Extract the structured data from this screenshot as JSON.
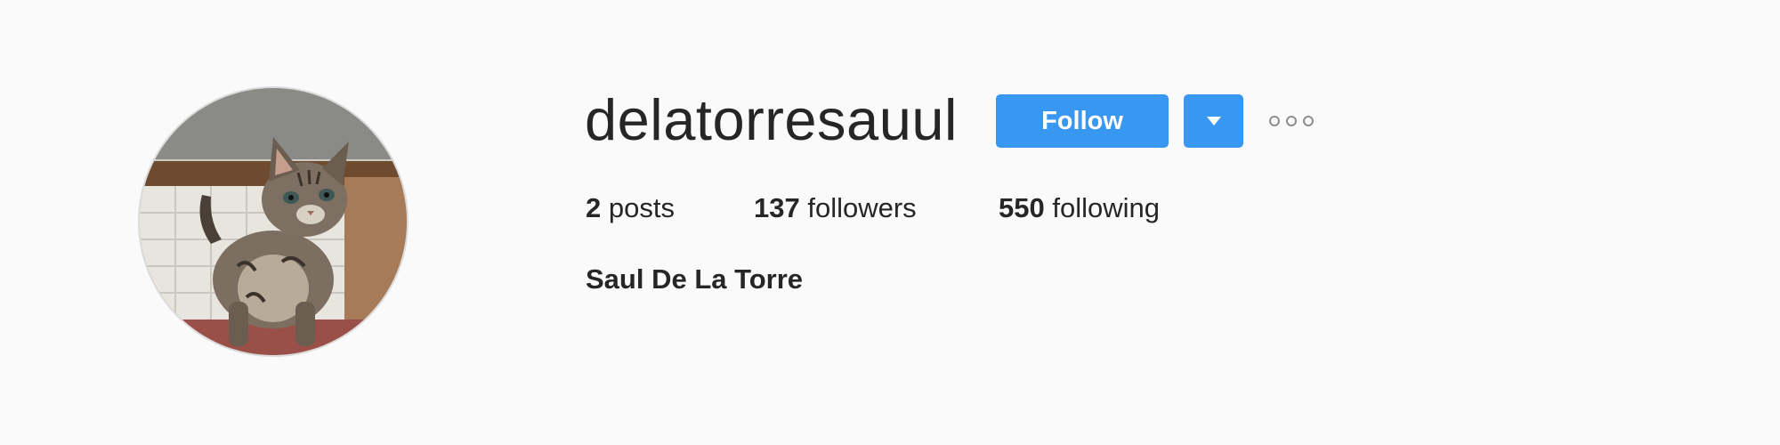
{
  "profile": {
    "username": "delatorresauul",
    "full_name": "Saul De La Torre",
    "follow_label": "Follow",
    "stats": {
      "posts_count": "2",
      "posts_label": "posts",
      "followers_count": "137",
      "followers_label": "followers",
      "following_count": "550",
      "following_label": "following"
    }
  },
  "icons": {
    "dropdown": "chevron-down-icon",
    "more": "more-options-icon"
  },
  "colors": {
    "accent": "#3897f0",
    "background": "#fafafa",
    "text": "#262626",
    "muted": "#8e8e8e"
  }
}
